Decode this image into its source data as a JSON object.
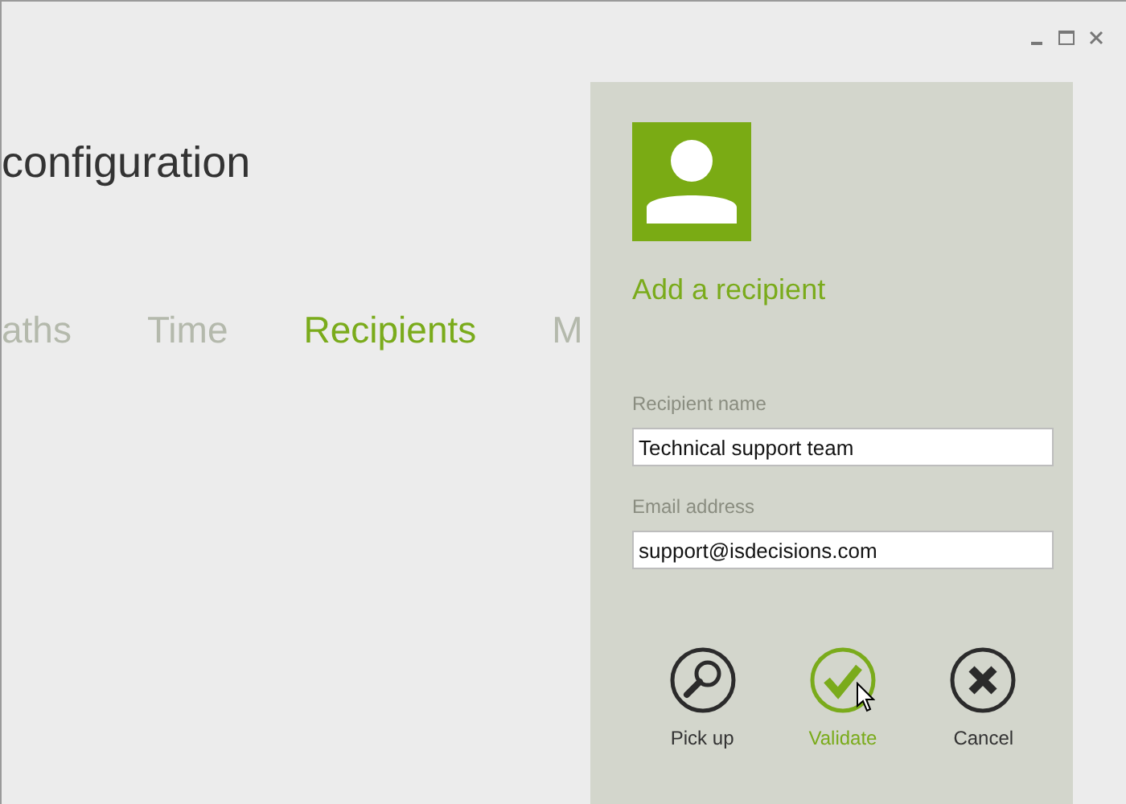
{
  "window": {
    "title": "configuration"
  },
  "tabs": [
    {
      "label": "aths",
      "selected": false
    },
    {
      "label": "Time",
      "selected": false
    },
    {
      "label": "Recipients",
      "selected": true
    },
    {
      "label": "M",
      "selected": false
    }
  ],
  "panel": {
    "title": "Add a recipient",
    "fields": [
      {
        "label": "Recipient name",
        "value": "Technical support team"
      },
      {
        "label": "Email address",
        "value": "support@isdecisions.com"
      }
    ],
    "buttons": [
      {
        "kind": "search",
        "label": "Pick up",
        "hovered": false
      },
      {
        "kind": "check",
        "label": "Validate",
        "hovered": true
      },
      {
        "kind": "close",
        "label": "Cancel",
        "hovered": false
      }
    ]
  }
}
